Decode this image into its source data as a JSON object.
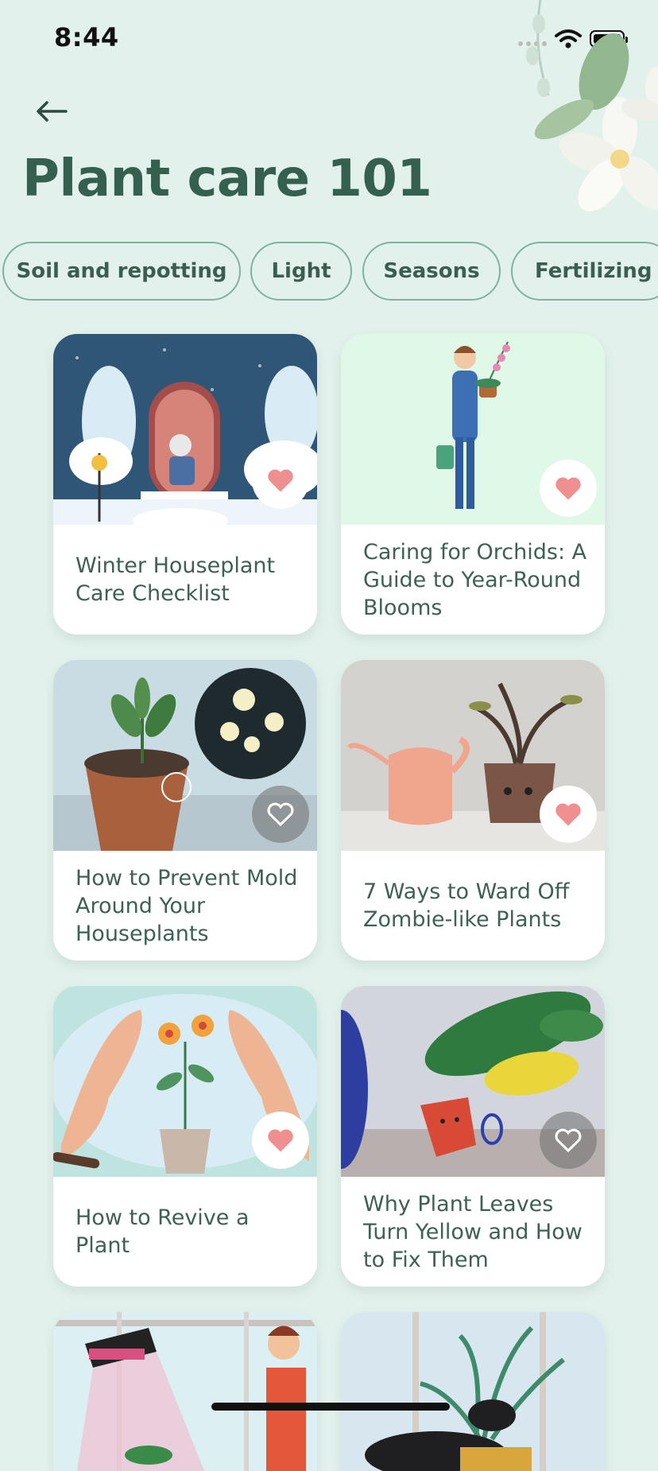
{
  "status_bar": {
    "time": "8:44"
  },
  "header": {
    "title": "Plant care 101"
  },
  "categories": [
    "Soil and repotting",
    "Light",
    "Seasons",
    "Fertilizing"
  ],
  "articles": [
    {
      "title": "Winter Houseplant Care Checklist",
      "favorited": true
    },
    {
      "title": "Caring for Orchids: A Guide to Year-Round Blooms",
      "favorited": true
    },
    {
      "title": "How to Prevent Mold Around Your Houseplants",
      "favorited": false
    },
    {
      "title": "7 Ways to Ward Off Zombie-like Plants",
      "favorited": true
    },
    {
      "title": "How to Revive a Plant",
      "favorited": true
    },
    {
      "title": "Why Plant Leaves Turn Yellow and How to Fix Them",
      "favorited": false
    }
  ],
  "icons": {
    "back": "arrow-left-icon",
    "favorite": "heart-icon",
    "wifi": "wifi-icon",
    "battery": "battery-icon",
    "signal": "signal-icon"
  },
  "colors": {
    "background": "#e3f1ec",
    "title": "#35604f",
    "chip_border": "#7fb39e",
    "heart_active": "#ef8f8f"
  }
}
